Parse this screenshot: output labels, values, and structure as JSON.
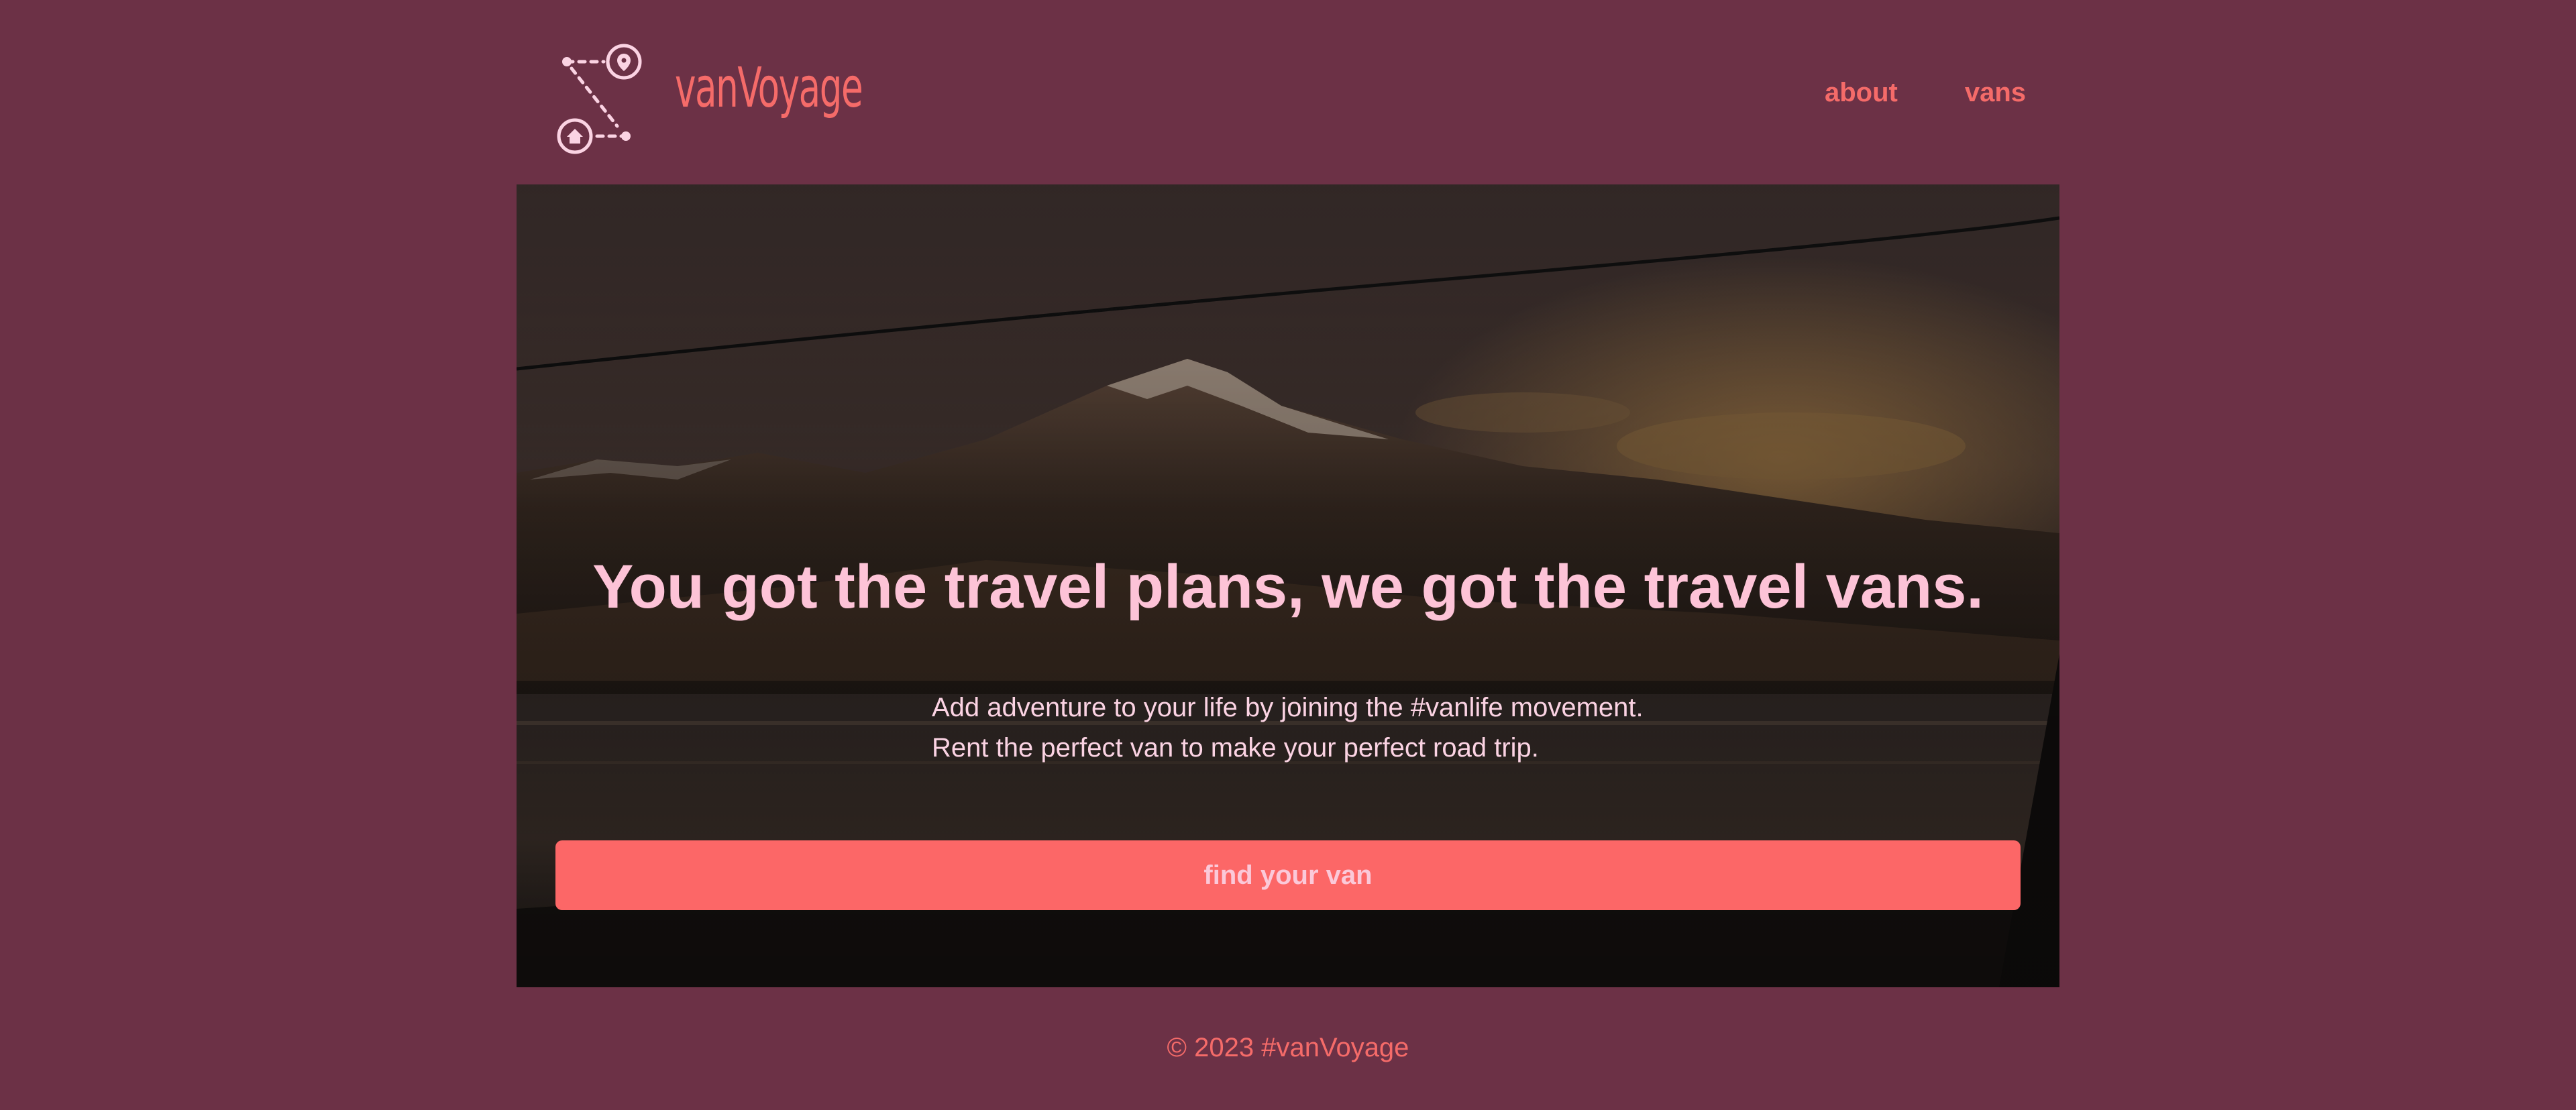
{
  "app": {
    "brand": "vanVoyage",
    "colors": {
      "background": "#6c3146",
      "accent": "#fc6767",
      "brand_text": "#f56b69",
      "hero_title": "#fdc3d7",
      "hero_text": "#fbd3e3",
      "logo_stroke": "#fbd3e3"
    }
  },
  "header": {
    "logo_icons": [
      "home-icon",
      "location-pin-icon"
    ],
    "nav": [
      {
        "label": "about"
      },
      {
        "label": "vans"
      }
    ]
  },
  "hero": {
    "background": "mountain-lake-photo",
    "title": "You got the travel plans, we got the travel vans.",
    "lines": [
      "Add adventure to your life by joining the #vanlife movement.",
      "Rent the perfect van to make your perfect road trip."
    ],
    "cta_label": "find your van"
  },
  "footer": {
    "text": "© 2023 #vanVoyage"
  }
}
